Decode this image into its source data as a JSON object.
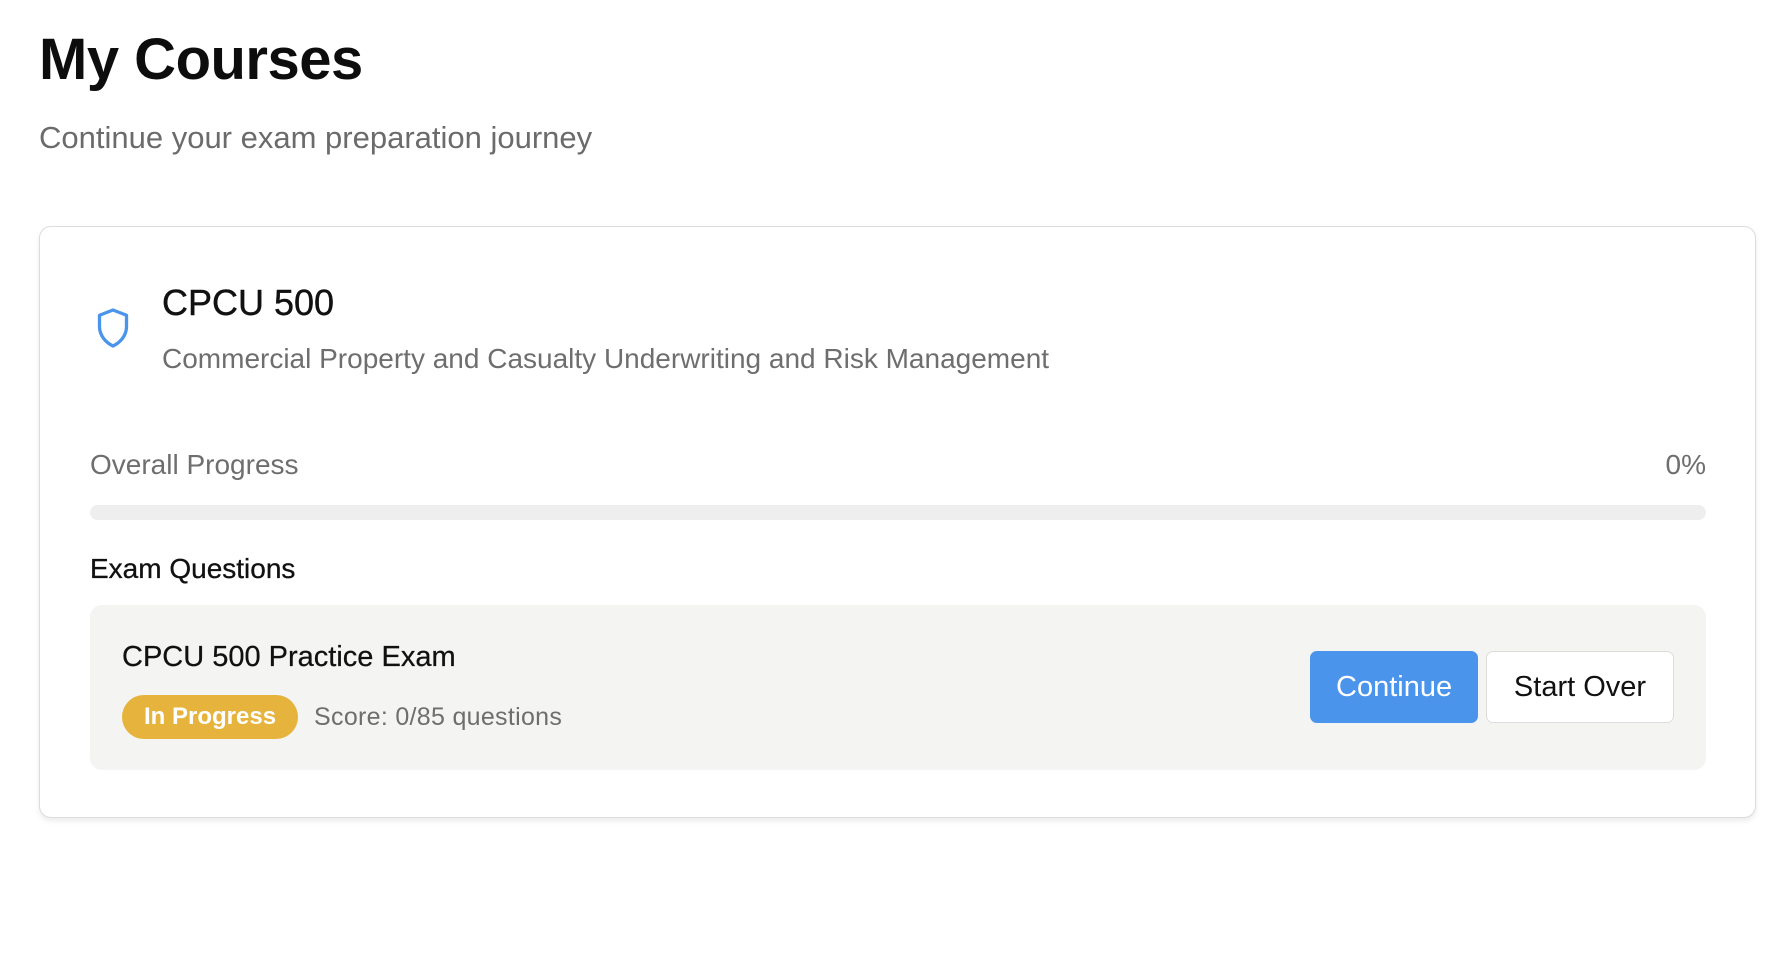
{
  "header": {
    "title": "My Courses",
    "subtitle": "Continue your exam preparation journey"
  },
  "course": {
    "icon": "shield-icon",
    "icon_color": "#4a94ec",
    "name": "CPCU 500",
    "description": "Commercial Property and Casualty Underwriting and Risk Management",
    "progress": {
      "label": "Overall Progress",
      "value_text": "0%",
      "value_percent": 0
    },
    "exams_section_label": "Exam Questions",
    "exams": [
      {
        "title": "CPCU 500 Practice Exam",
        "status": "In Progress",
        "status_color": "#e6b43c",
        "score_text": "Score: 0/85 questions",
        "continue_label": "Continue",
        "start_over_label": "Start Over"
      }
    ]
  },
  "colors": {
    "accent": "#4a94ec",
    "badge_in_progress": "#e6b43c",
    "muted_text": "#6e6e6e",
    "item_background": "#f4f4f2"
  }
}
